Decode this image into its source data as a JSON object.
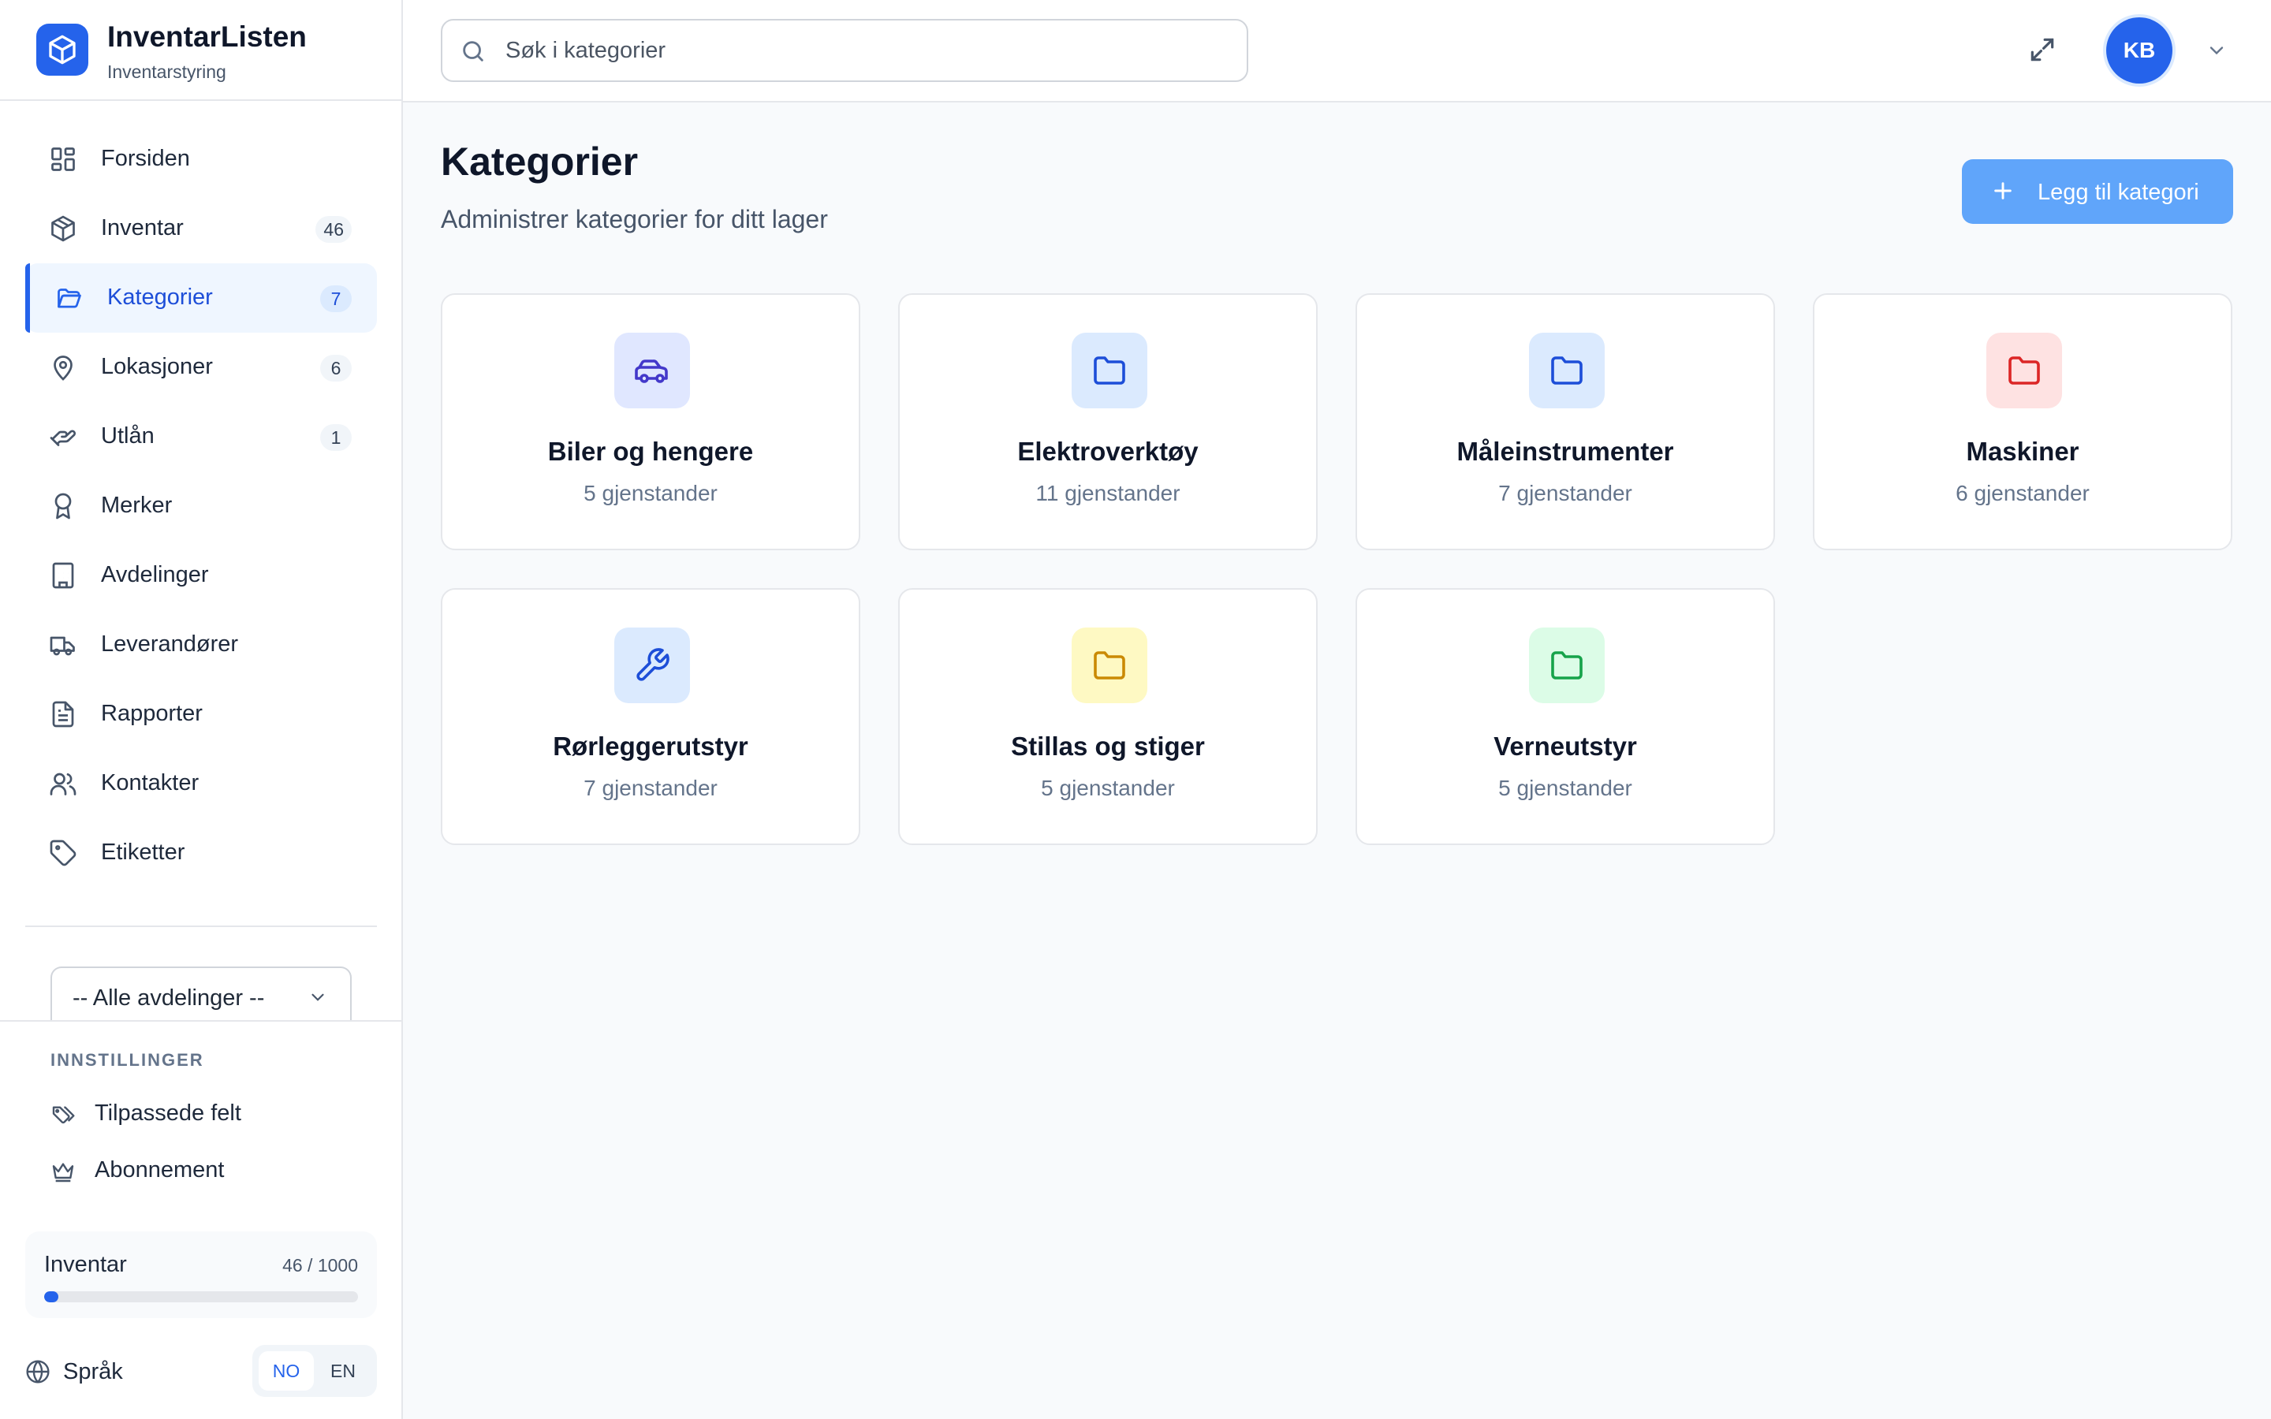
{
  "brand": {
    "name": "InventarListen",
    "subtitle": "Inventarstyring"
  },
  "nav": [
    {
      "label": "Forsiden",
      "badge": "",
      "icon": "grid-icon"
    },
    {
      "label": "Inventar",
      "badge": "46",
      "icon": "box-icon"
    },
    {
      "label": "Kategorier",
      "badge": "7",
      "icon": "folder-open-icon",
      "active": true
    },
    {
      "label": "Lokasjoner",
      "badge": "6",
      "icon": "map-pin-icon"
    },
    {
      "label": "Utlån",
      "badge": "1",
      "icon": "hand-icon"
    },
    {
      "label": "Merker",
      "badge": "",
      "icon": "award-icon"
    },
    {
      "label": "Avdelinger",
      "badge": "",
      "icon": "building-icon"
    },
    {
      "label": "Leverandører",
      "badge": "",
      "icon": "truck-icon"
    },
    {
      "label": "Rapporter",
      "badge": "",
      "icon": "file-text-icon"
    },
    {
      "label": "Kontakter",
      "badge": "",
      "icon": "users-icon"
    },
    {
      "label": "Etiketter",
      "badge": "",
      "icon": "tag-icon"
    }
  ],
  "department_select": {
    "value": "-- Alle avdelinger --"
  },
  "settings": {
    "title": "INNSTILLINGER",
    "items": [
      {
        "label": "Tilpassede felt",
        "icon": "tags-icon"
      },
      {
        "label": "Abonnement",
        "icon": "crown-icon"
      }
    ]
  },
  "usage": {
    "label": "Inventar",
    "count": "46 / 1000",
    "fraction": 0.046
  },
  "language": {
    "label": "Språk",
    "options": [
      "NO",
      "EN"
    ],
    "selected": "NO"
  },
  "header": {
    "search_placeholder": "Søk i kategorier",
    "avatar_initials": "KB"
  },
  "main": {
    "title": "Kategorier",
    "subtitle": "Administrer kategorier for ditt lager",
    "add_button": "Legg til kategori"
  },
  "categories": [
    {
      "name": "Biler og hengere",
      "count": "5 gjenstander",
      "icon": "car-icon",
      "bg": "#e0e7ff",
      "fg": "#4338ca"
    },
    {
      "name": "Elektroverktøy",
      "count": "11 gjenstander",
      "icon": "folder-icon",
      "bg": "#dbeafe",
      "fg": "#1d4ed8"
    },
    {
      "name": "Måleinstrumenter",
      "count": "7 gjenstander",
      "icon": "folder-icon",
      "bg": "#dbeafe",
      "fg": "#1d4ed8"
    },
    {
      "name": "Maskiner",
      "count": "6 gjenstander",
      "icon": "folder-icon",
      "bg": "#fee2e2",
      "fg": "#dc2626"
    },
    {
      "name": "Rørleggerutstyr",
      "count": "7 gjenstander",
      "icon": "wrench-icon",
      "bg": "#dbeafe",
      "fg": "#1d4ed8"
    },
    {
      "name": "Stillas og stiger",
      "count": "5 gjenstander",
      "icon": "folder-icon",
      "bg": "#fef9c3",
      "fg": "#ca8a04"
    },
    {
      "name": "Verneutstyr",
      "count": "5 gjenstander",
      "icon": "folder-icon",
      "bg": "#dcfce7",
      "fg": "#16a34a"
    }
  ],
  "colors": {
    "accent": "#2563eb",
    "button": "#60a5fa"
  }
}
